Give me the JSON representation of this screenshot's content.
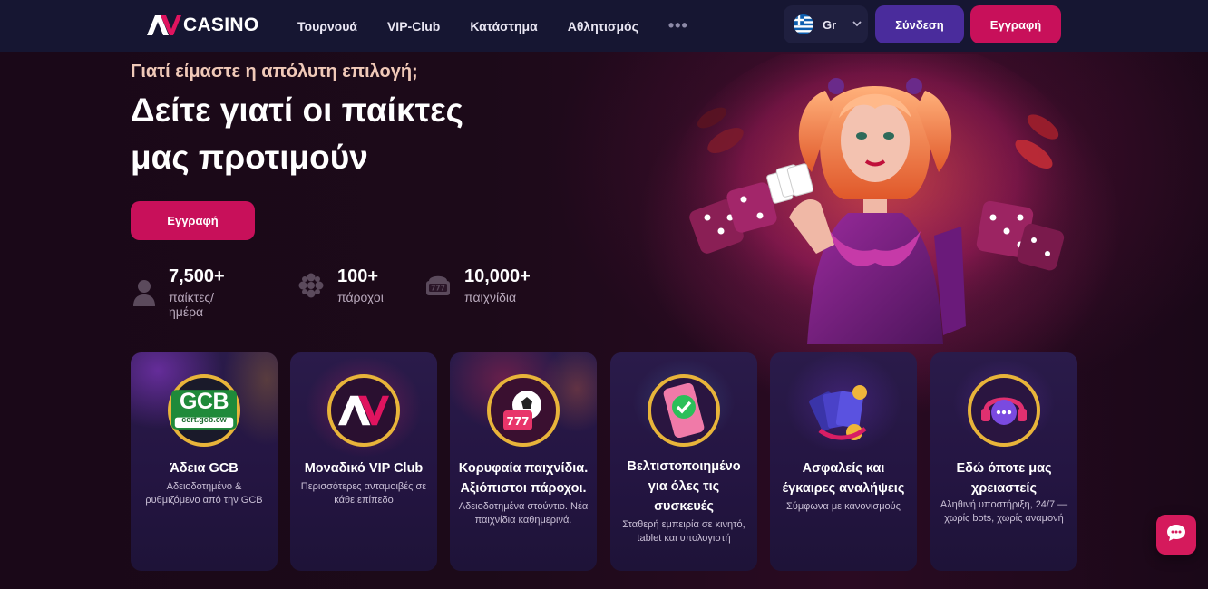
{
  "header": {
    "logo_text": "CASINO",
    "nav": [
      "Τουρνουά",
      "VIP-Club",
      "Κατάστημα",
      "Αθλητισμός"
    ],
    "more": "•••",
    "language": {
      "code": "Gr",
      "icon": "greece-flag-icon"
    },
    "login_label": "Σύνδεση",
    "register_label": "Εγγραφή"
  },
  "hero": {
    "eyebrow": "Γιατί είμαστε η απόλυτη επιλογή;",
    "title_line1": "Δείτε γιατί οι παίκτες",
    "title_line2": "μας προτιμούν",
    "register_label": "Εγγραφή",
    "stats": [
      {
        "value": "7,500+",
        "label": "παίκτες/ημέρα",
        "icon": "user-icon"
      },
      {
        "value": "100+",
        "label": "πάροχοι",
        "icon": "providers-icon"
      },
      {
        "value": "10,000+",
        "label": "παιχνίδια",
        "icon": "slot-machine-icon"
      }
    ]
  },
  "cards": [
    {
      "title": "Άδεια GCB",
      "desc": "Αδειοδοτημένο & ρυθμιζόμενο από την GCB",
      "icon": "gcb-license-icon",
      "badge_text": "GCB",
      "badge_sub": "cert.gcb.cw"
    },
    {
      "title": "Μοναδικό VIP Club",
      "desc": "Περισσότερες ανταμοιβές σε κάθε επίπεδο",
      "icon": "vip-logo-icon"
    },
    {
      "title": "Κορυφαία παιχνίδια. Αξιόπιστοι πάροχοι.",
      "desc": "Αδειοδοτημένα στούντιο. Νέα παιχνίδια καθημερινά.",
      "icon": "games-icon"
    },
    {
      "title": "Βελτιστοποιημένο για όλες τις συσκευές",
      "desc": "Σταθερή εμπειρία σε κινητό, tablet και υπολογιστή",
      "icon": "phone-check-icon"
    },
    {
      "title": "Ασφαλείς και έγκαιρες αναλήψεις",
      "desc": "Σύμφωνα με κανονισμούς",
      "icon": "cards-coins-icon"
    },
    {
      "title": "Εδώ όποτε μας χρειαστείς",
      "desc": "Αληθινή υποστήριξη, 24/7 — χωρίς bots, χωρίς αναμονή",
      "icon": "support-chat-icon"
    }
  ],
  "chat": {
    "icon": "chat-bubble-icon"
  },
  "colors": {
    "accent": "#c8105a",
    "login": "#4a2c9c",
    "header": "#161632"
  }
}
